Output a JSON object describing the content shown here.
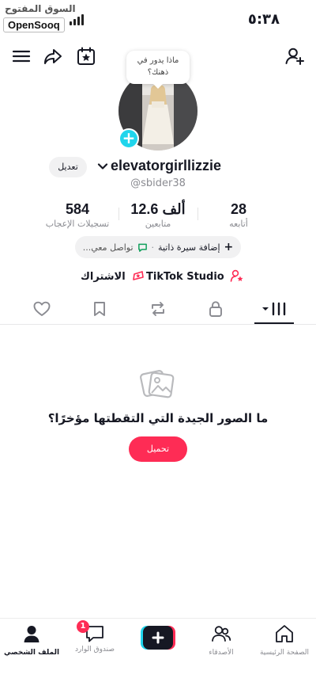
{
  "status": {
    "watermark_arabic": "السوق المفتوح",
    "watermark_brand": "OpenSooq",
    "time": "٥:٣٨"
  },
  "topnav": {
    "menu_icon": "menu-icon",
    "share_icon": "share-icon",
    "calendar_icon": "calendar-star-icon",
    "add_friend_icon": "add-user-icon"
  },
  "profile": {
    "bubble_line1": "ماذا يدور في",
    "bubble_line2": "ذهنك؟",
    "edit_label": "تعديل",
    "username": "elevatorgirllizzie",
    "handle": "@sbider38",
    "stats": [
      {
        "value": "28",
        "label": "أتابعه"
      },
      {
        "value": "12.6 ألف",
        "label": "متابعين"
      },
      {
        "value": "584",
        "label": "تسجيلات الإعجاب"
      }
    ],
    "pill_add_bio": "إضافة سيرة ذاتية",
    "pill_contact": "تواصل معي...",
    "studio_label": "TikTok Studio",
    "subscribe_label": "الاشتراك"
  },
  "tabs": [
    "videos-grid",
    "private",
    "reposts",
    "favorites",
    "liked"
  ],
  "empty_state": {
    "text": "ما الصور الجيدة التي التقطتها مؤخرًا؟",
    "button": "تحميل"
  },
  "bottomnav": {
    "profile": "الملف الشخصي",
    "inbox": "صندوق الوارد",
    "inbox_badge": "1",
    "friends": "الأصدقاء",
    "home": "الصفحة الرئيسية"
  },
  "colors": {
    "accent": "#fe2c55",
    "cyan": "#20d5ec",
    "text": "#161823",
    "muted": "#8a8b91"
  }
}
